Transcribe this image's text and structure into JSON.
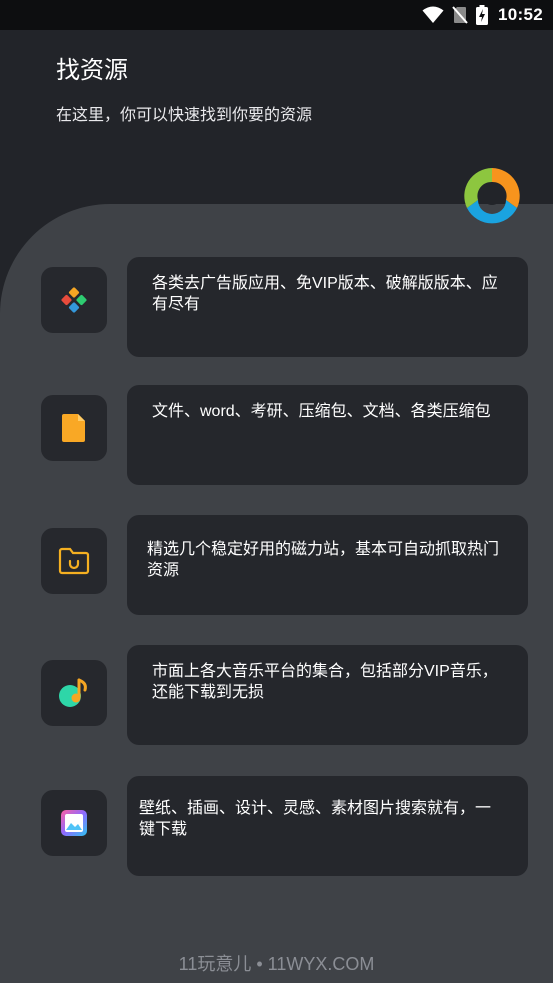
{
  "status_bar": {
    "time": "10:52"
  },
  "header": {
    "title": "找资源",
    "subtitle": "在这里，你可以快速找到你要的资源"
  },
  "items": [
    {
      "icon": "apps-icon",
      "text": "各类去广告版应用、免VIP版本、破解版版本、应有尽有"
    },
    {
      "icon": "document-icon",
      "text": "文件、word、考研、压缩包、文档、各类压缩包"
    },
    {
      "icon": "folder-icon",
      "text": "精选几个稳定好用的磁力站，基本可自动抓取热门资源"
    },
    {
      "icon": "music-icon",
      "text": "市面上各大音乐平台的集合，包括部分VIP音乐，还能下载到无损"
    },
    {
      "icon": "image-icon",
      "text": "壁纸、插画、设计、灵感、素材图片搜索就有，一键下载"
    }
  ],
  "footer": {
    "watermark": "11玩意儿 • 11WYX.COM"
  },
  "colors": {
    "background": "#222429",
    "panel": "#3f4247",
    "card": "#25272c",
    "logo_orange": "#f7941d",
    "logo_green": "#8dc63f",
    "logo_blue": "#1aa3e0"
  }
}
